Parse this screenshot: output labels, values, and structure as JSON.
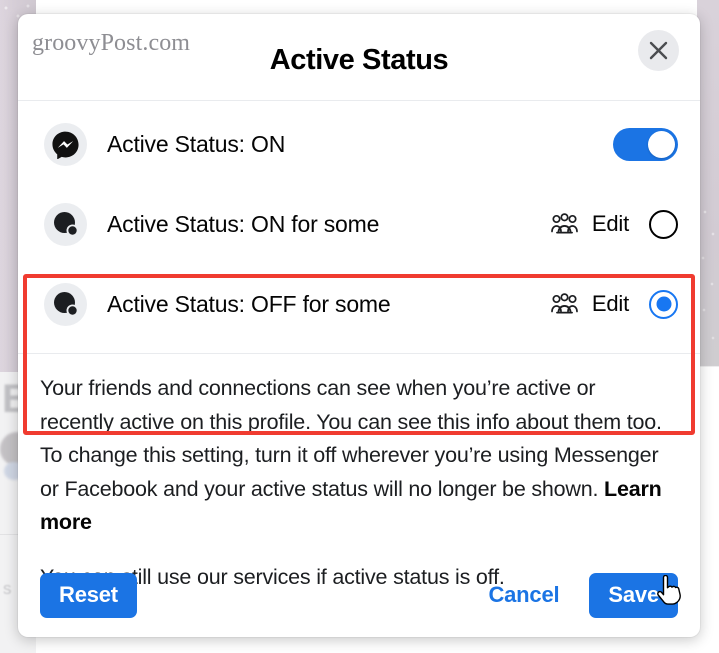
{
  "dialog": {
    "watermark": "groovyPost.com",
    "title": "Active Status",
    "close_label": "Close"
  },
  "rows": [
    {
      "icon": "messenger-icon",
      "label": "Active Status: ON",
      "control": "toggle",
      "toggle_on": true
    },
    {
      "icon": "avatar-icon",
      "label": "Active Status: ON for some",
      "edit_label": "Edit",
      "edit_icon": "people-group-icon",
      "control": "radio",
      "selected": false
    },
    {
      "icon": "avatar-icon",
      "label": "Active Status: OFF for some",
      "edit_label": "Edit",
      "edit_icon": "people-group-icon",
      "control": "radio",
      "selected": true
    }
  ],
  "body": {
    "paragraph1_part1": "Your friends and connections can see when you’re active or recently active on this profile. You can see this info about them too. To change this setting, turn it off wherever you’re using Messenger or Facebook and your active status will no longer be shown. ",
    "learn_more": "Learn more",
    "paragraph2": "You can still use our services if active status is off."
  },
  "footer": {
    "reset_label": "Reset",
    "cancel_label": "Cancel",
    "save_label": "Save"
  },
  "colors": {
    "accent_blue": "#1b74e4",
    "highlight_red": "#f03b30",
    "avatar_bg": "#ebedf0",
    "close_bg": "#e9eaed"
  }
}
